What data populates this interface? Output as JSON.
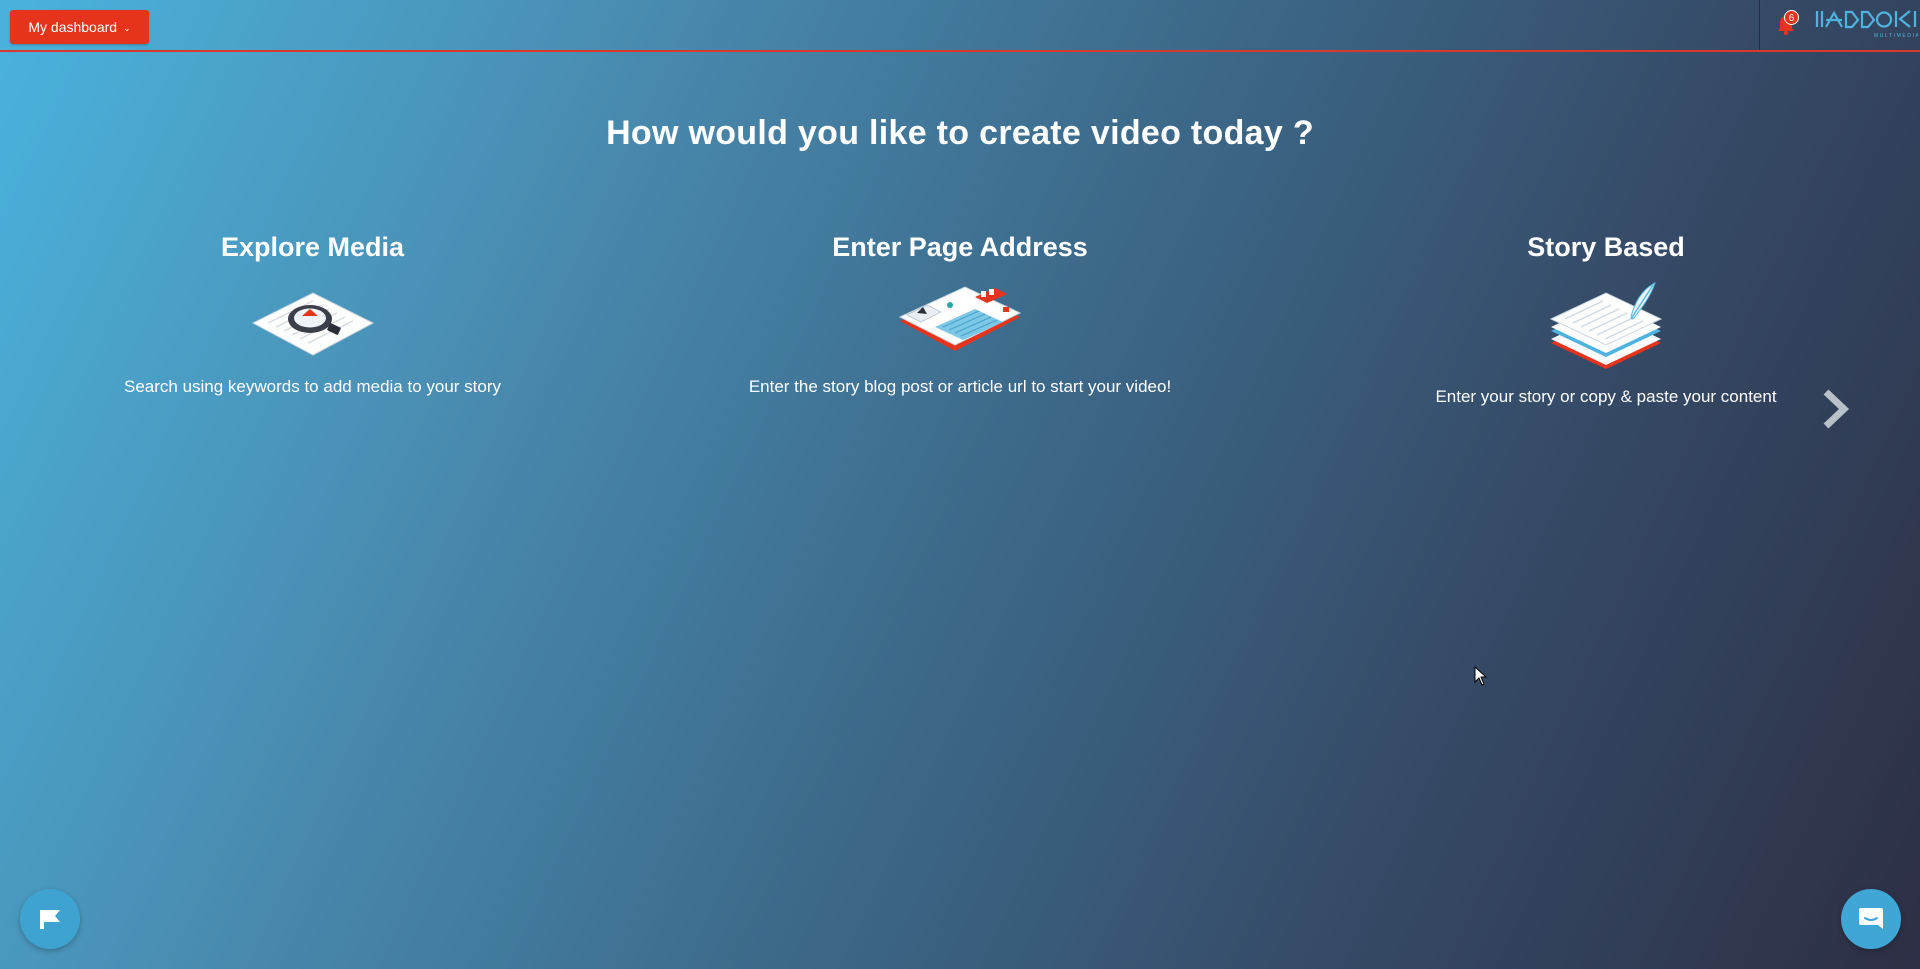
{
  "header": {
    "dashboard_button": "My dashboard",
    "notification_count": "6",
    "logo_text": "MADDOK",
    "logo_subtext": "MULTIMEDIAS"
  },
  "main": {
    "headline": "How would you like to create video today ?",
    "options": [
      {
        "title": "Explore Media",
        "description": "Search using keywords to add media to your story",
        "icon": "magnifier-document-icon"
      },
      {
        "title": "Enter Page Address",
        "description": "Enter the story blog post or article url to start your video!",
        "icon": "webpage-icon"
      },
      {
        "title": "Story Based",
        "description": "Enter your story or copy & paste your content",
        "icon": "stacked-pages-quill-icon"
      }
    ],
    "next_icon": "chevron-right-icon"
  },
  "widgets": {
    "left_icon": "flag-icon",
    "right_icon": "chat-icon"
  },
  "colors": {
    "accent": "#e5331c",
    "widget_blue": "#40a6d6",
    "gradient_start": "#4ab3dd",
    "gradient_end": "#2d2f45"
  }
}
